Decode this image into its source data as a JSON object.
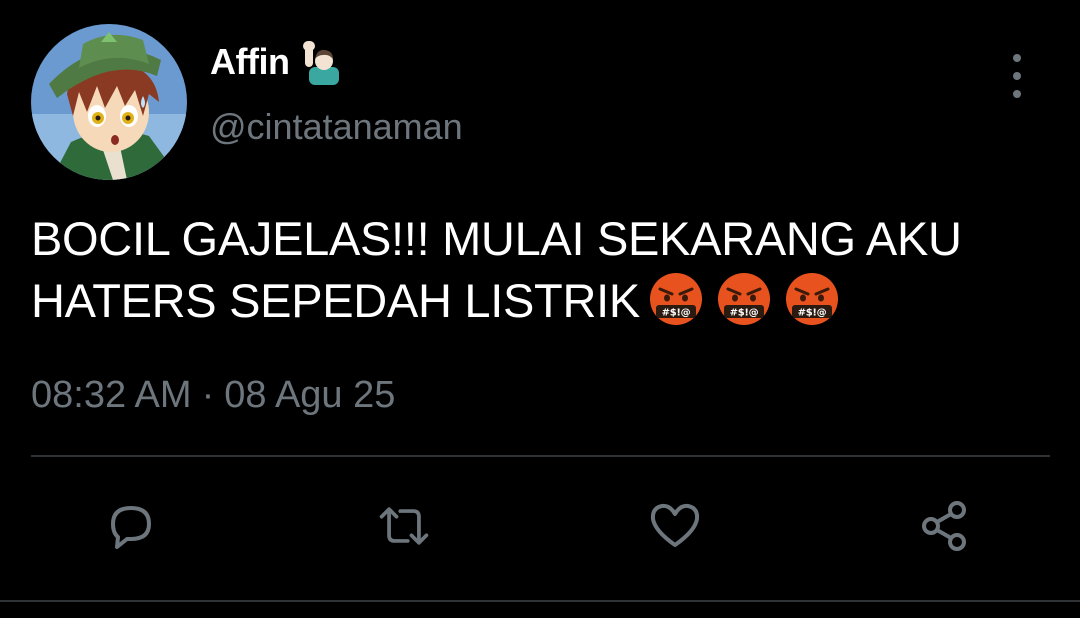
{
  "user": {
    "display_name": "Affin",
    "name_emoji": "person-raising-hand-emoji",
    "handle": "@cintatanaman",
    "avatar": "anime-character-avatar"
  },
  "tweet": {
    "text": "BOCIL GAJELAS!!! MULAI SEKARANG AKU HATERS SEPEDAH LISTRIK",
    "emojis": [
      "cursing-face-emoji",
      "cursing-face-emoji",
      "cursing-face-emoji"
    ],
    "time": "08:32 AM",
    "separator": "·",
    "date": "08 Agu 25"
  },
  "actions": [
    {
      "name": "reply",
      "icon": "comment-icon"
    },
    {
      "name": "retweet",
      "icon": "retweet-icon"
    },
    {
      "name": "like",
      "icon": "heart-icon"
    },
    {
      "name": "share",
      "icon": "share-icon"
    }
  ],
  "menu": {
    "icon": "more-vertical-icon"
  },
  "colors": {
    "background": "#000000",
    "text": "#ffffff",
    "secondary": "#6e767d",
    "divider": "#2f3336"
  }
}
